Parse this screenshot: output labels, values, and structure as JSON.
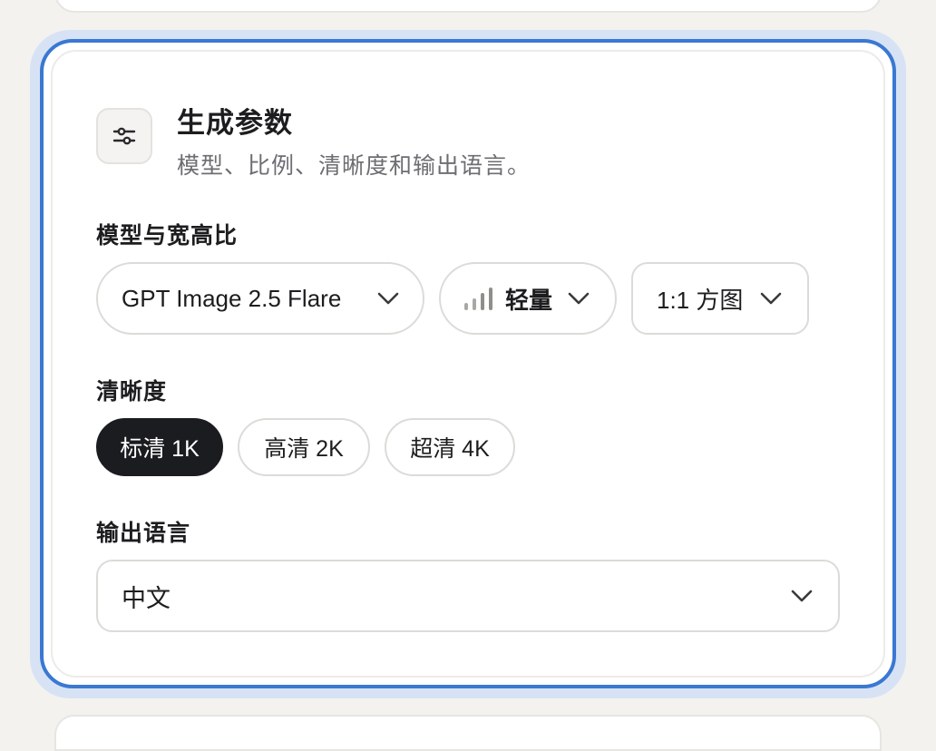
{
  "header": {
    "icon": "sliders-icon",
    "title": "生成参数",
    "subtitle": "模型、比例、清晰度和输出语言。"
  },
  "model_section": {
    "label": "模型与宽高比",
    "model_value": "GPT Image 2.5 Flare",
    "speed_icon": "signal-bars-icon",
    "speed_value": "轻量",
    "ratio_value": "1:1 方图"
  },
  "resolution_section": {
    "label": "清晰度",
    "options": [
      "标清 1K",
      "高清 2K",
      "超清 4K"
    ],
    "selected": "标清 1K"
  },
  "language_section": {
    "label": "输出语言",
    "value": "中文"
  },
  "colors": {
    "focus_ring": "#3a78d2",
    "active_chip": "#1b1c20",
    "muted_text": "#6d6d72"
  }
}
